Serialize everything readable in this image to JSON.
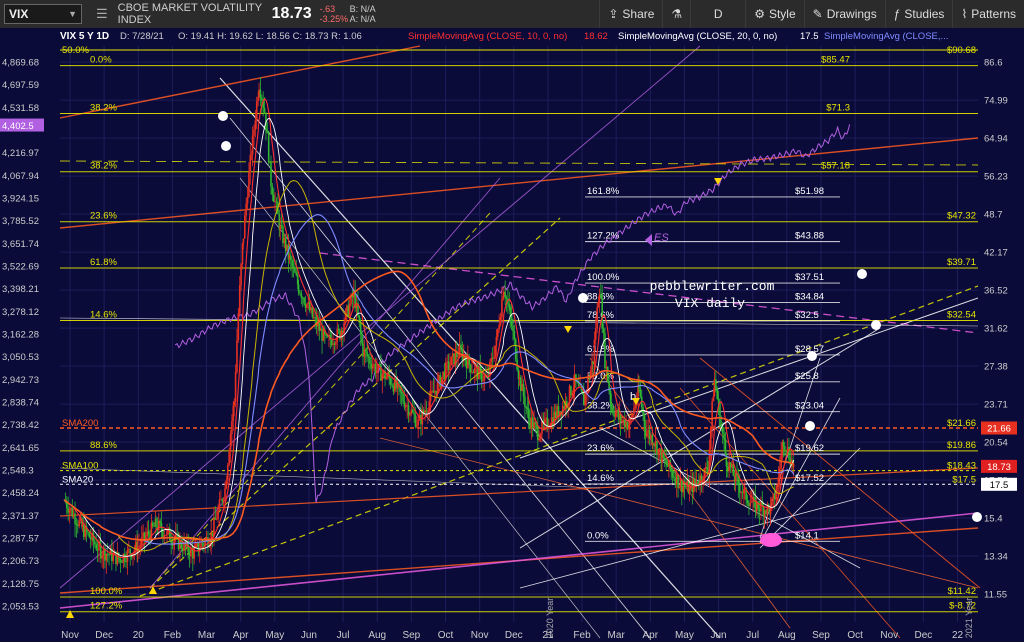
{
  "toolbar": {
    "symbol": "VIX",
    "title": "CBOE MARKET VOLATILITY INDEX",
    "last": "18.73",
    "change": "-.63",
    "change_pct": "-3.25%",
    "bid_label": "B: N/A",
    "ask_label": "A: N/A",
    "share": "Share",
    "interval": "D",
    "style": "Style",
    "drawings": "Drawings",
    "studies": "Studies",
    "patterns": "Patterns"
  },
  "header": {
    "text": "VIX 5 Y 1D",
    "date": "D: 7/28/21",
    "ohlc": "O: 19.41  H: 19.62  L: 18.56  C: 18.73  R: 1.06",
    "sma10": "SimpleMovingAvg (CLOSE, 10, 0, no)",
    "sma10_val": "18.62",
    "sma20": "SimpleMovingAvg (CLOSE, 20, 0, no)",
    "sma20_val": "17.5",
    "sma_more": "SimpleMovingAvg (CLOSE,..."
  },
  "colors": {
    "background": "#0b0b3a",
    "candle_up": "#2fb52f",
    "candle_down": "#e83020",
    "fib": "#e6e600",
    "es": "#b060e0",
    "sma200": "#ff4a1a",
    "current_price": "#e02020"
  },
  "chart_data": {
    "type": "line",
    "x_ticks": [
      "Nov",
      "Dec",
      "20",
      "Feb",
      "Mar",
      "Apr",
      "May",
      "Jun",
      "Jul",
      "Aug",
      "Sep",
      "Oct",
      "Nov",
      "Dec",
      "21",
      "Feb",
      "Mar",
      "Apr",
      "May",
      "Jun",
      "Jul",
      "Aug",
      "Sep",
      "Oct",
      "Nov",
      "Dec",
      "22"
    ],
    "right_axis": {
      "scale": "log",
      "ticks": [
        86.6,
        74.99,
        64.94,
        56.23,
        48.7,
        42.17,
        36.52,
        31.62,
        27.38,
        23.71,
        20.54,
        17.78,
        15.4,
        13.34,
        11.55
      ],
      "markers": [
        {
          "label": "21.66",
          "value": 21.66,
          "color": "#e83020"
        },
        {
          "label": "18.73",
          "value": 18.73,
          "color": "#e02020"
        },
        {
          "label": "17.5",
          "value": 17.5,
          "color": "#ffffff"
        }
      ]
    },
    "left_axis": {
      "ticks": [
        "4,869.68",
        "4,697.59",
        "4,531.58",
        "4,402.5",
        "4,216.97",
        "4,067.94",
        "3,924.15",
        "3,785.52",
        "3,651.74",
        "3,522.69",
        "3,398.21",
        "3,278.12",
        "3,162.28",
        "3,050.53",
        "2,942.73",
        "2,838.74",
        "2,738.42",
        "2,641.65",
        "2,548.3",
        "2,458.24",
        "2,371.37",
        "2,287.57",
        "2,206.73",
        "2,128.75",
        "2,053.53"
      ],
      "highlight": "4,402.5"
    },
    "fib_left": [
      {
        "pct": "0.0%",
        "price": "$85.47",
        "value": 85.47
      },
      {
        "pct": "38.2%",
        "price": "$71.3",
        "value": 71.3
      },
      {
        "pct": "38.2%",
        "price": "$57.18",
        "value": 57.18
      },
      {
        "pct": "23.6%",
        "price": "$47.32",
        "value": 47.32
      },
      {
        "pct": "61.8%",
        "price": "$39.71",
        "value": 39.71
      },
      {
        "pct": "14.6%",
        "price": "$32.54",
        "value": 32.54
      },
      {
        "pct": "88.6%",
        "price": "$19.86",
        "value": 19.86
      },
      {
        "pct": "100.0%",
        "price": "$11.42",
        "value": 11.42
      },
      {
        "pct": "127.2%",
        "price": "$-8.72",
        "value": 10.8
      }
    ],
    "fib_top": {
      "pct": "50.0%",
      "price": "$90.68",
      "value": 90.68
    },
    "fib_right": [
      {
        "pct": "161.8%",
        "price": "$51.98",
        "value": 51.98
      },
      {
        "pct": "127.2%",
        "price": "$43.88",
        "value": 43.88
      },
      {
        "pct": "100.0%",
        "price": "$37.51",
        "value": 37.51
      },
      {
        "pct": "88.6%",
        "price": "$34.84",
        "value": 34.84
      },
      {
        "pct": "78.6%",
        "price": "$32.5",
        "value": 32.5
      },
      {
        "pct": "61.8%",
        "price": "$28.57",
        "value": 28.57
      },
      {
        "pct": "50.0%",
        "price": "$25.8",
        "value": 25.8
      },
      {
        "pct": "38.2%",
        "price": "$23.04",
        "value": 23.04
      },
      {
        "pct": "23.6%",
        "price": "$19.62",
        "value": 19.62
      },
      {
        "pct": "14.6%",
        "price": "$17.52",
        "value": 17.52
      },
      {
        "pct": "0.0%",
        "price": "$14.1",
        "value": 14.1
      }
    ],
    "extra_price_labels": [
      {
        "label": "$21.66",
        "value": 21.66
      },
      {
        "label": "$18.43",
        "value": 18.43
      },
      {
        "label": "$17.5",
        "value": 17.5
      }
    ],
    "sma_labels": [
      "SMA200",
      "SMA100",
      "SMA20"
    ],
    "annotations": {
      "site": "pebblewriter.com",
      "chart_name": "VIX daily",
      "es_label": "ES",
      "b_label": "b",
      "year_2020": "2020 Year",
      "year_2021": "2021 Year"
    },
    "vix_anchors": [
      [
        0,
        16.5
      ],
      [
        20,
        14.8
      ],
      [
        40,
        13.6
      ],
      [
        60,
        13.2
      ],
      [
        80,
        13.8
      ],
      [
        100,
        15.0
      ],
      [
        120,
        14.2
      ],
      [
        140,
        13.5
      ],
      [
        160,
        14.4
      ],
      [
        175,
        17.2
      ],
      [
        185,
        24
      ],
      [
        195,
        45
      ],
      [
        205,
        64
      ],
      [
        212,
        80
      ],
      [
        218,
        72
      ],
      [
        225,
        55
      ],
      [
        235,
        46
      ],
      [
        245,
        41
      ],
      [
        255,
        37
      ],
      [
        270,
        33
      ],
      [
        285,
        30
      ],
      [
        300,
        31
      ],
      [
        315,
        36
      ],
      [
        325,
        29
      ],
      [
        340,
        27
      ],
      [
        355,
        26
      ],
      [
        370,
        24
      ],
      [
        385,
        22
      ],
      [
        400,
        24.5
      ],
      [
        415,
        27
      ],
      [
        430,
        29
      ],
      [
        445,
        27
      ],
      [
        460,
        26
      ],
      [
        470,
        30
      ],
      [
        478,
        37
      ],
      [
        485,
        33
      ],
      [
        495,
        26
      ],
      [
        505,
        22.5
      ],
      [
        515,
        21.3
      ],
      [
        530,
        22.4
      ],
      [
        545,
        23.8
      ],
      [
        555,
        25.8
      ],
      [
        565,
        24
      ],
      [
        575,
        28
      ],
      [
        582,
        37
      ],
      [
        588,
        28
      ],
      [
        595,
        23.5
      ],
      [
        605,
        22.3
      ],
      [
        615,
        22
      ],
      [
        625,
        25
      ],
      [
        632,
        21.5
      ],
      [
        640,
        20.8
      ],
      [
        650,
        19.3
      ],
      [
        660,
        18.4
      ],
      [
        670,
        17.5
      ],
      [
        680,
        17.2
      ],
      [
        690,
        17.8
      ],
      [
        700,
        18.6
      ],
      [
        707,
        26
      ],
      [
        713,
        22.5
      ],
      [
        720,
        19.2
      ],
      [
        730,
        17.8
      ],
      [
        740,
        16.8
      ],
      [
        750,
        16.2
      ],
      [
        760,
        16.0
      ],
      [
        768,
        15.9
      ],
      [
        775,
        17.2
      ],
      [
        782,
        20.8
      ],
      [
        788,
        19.6
      ],
      [
        793,
        18.73
      ]
    ],
    "es_anchors": [
      [
        60,
        3100
      ],
      [
        80,
        3140
      ],
      [
        100,
        3200
      ],
      [
        120,
        3240
      ],
      [
        140,
        3260
      ],
      [
        155,
        3300
      ],
      [
        165,
        3340
      ],
      [
        180,
        3360
      ],
      [
        195,
        3230
      ],
      [
        205,
        2980
      ],
      [
        213,
        2420
      ],
      [
        220,
        2480
      ],
      [
        232,
        2700
      ],
      [
        245,
        2800
      ],
      [
        260,
        2900
      ],
      [
        275,
        2950
      ],
      [
        290,
        3050
      ],
      [
        305,
        3100
      ],
      [
        320,
        3150
      ],
      [
        335,
        3200
      ],
      [
        350,
        3250
      ],
      [
        365,
        3300
      ],
      [
        380,
        3330
      ],
      [
        395,
        3350
      ],
      [
        410,
        3380
      ],
      [
        425,
        3420
      ],
      [
        435,
        3360
      ],
      [
        448,
        3300
      ],
      [
        460,
        3340
      ],
      [
        475,
        3410
      ],
      [
        485,
        3330
      ],
      [
        495,
        3440
      ],
      [
        510,
        3560
      ],
      [
        525,
        3640
      ],
      [
        540,
        3700
      ],
      [
        555,
        3760
      ],
      [
        570,
        3820
      ],
      [
        585,
        3860
      ],
      [
        595,
        3880
      ],
      [
        605,
        3820
      ],
      [
        615,
        3900
      ],
      [
        630,
        3930
      ],
      [
        645,
        3980
      ],
      [
        660,
        4080
      ],
      [
        675,
        4140
      ],
      [
        690,
        4170
      ],
      [
        705,
        4180
      ],
      [
        720,
        4200
      ],
      [
        735,
        4230
      ],
      [
        745,
        4190
      ],
      [
        760,
        4260
      ],
      [
        770,
        4300
      ],
      [
        780,
        4370
      ],
      [
        786,
        4310
      ],
      [
        793,
        4400
      ]
    ]
  }
}
